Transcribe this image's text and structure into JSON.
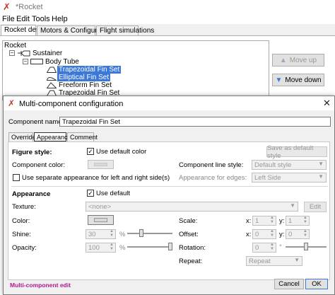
{
  "window": {
    "title": "*Rocket"
  },
  "menu": [
    "File",
    "Edit",
    "Tools",
    "Help"
  ],
  "main_tabs": [
    "Rocket design",
    "Motors & Configuration",
    "Flight simulations"
  ],
  "tree": {
    "root": "Rocket",
    "stage": "Sustainer",
    "body": "Body Tube",
    "items": [
      "Trapezoidal Fin Set",
      "Elliptical Fin Set",
      "Freeform Fin Set",
      "Trapezoidal Fin Set"
    ]
  },
  "side_buttons": {
    "move_up": "Move up",
    "move_down": "Move down"
  },
  "dialog": {
    "title": "Multi-component configuration",
    "component_name_label": "Component name:",
    "component_name_value": "Trapezoidal Fin Set",
    "tabs": [
      "Override",
      "Appearance",
      "Comment"
    ],
    "figure_style": {
      "heading": "Figure style:",
      "use_default_color": "Use default color",
      "save_default_style": "Save as default style",
      "component_color_label": "Component color:",
      "component_line_style_label": "Component line style:",
      "line_style_value": "Default style",
      "separate_appearance": "Use separate appearance for left and right side(s)",
      "appearance_edges_label": "Appearance for edges:",
      "edges_value": "Left Side"
    },
    "appearance": {
      "heading": "Appearance",
      "use_default": "Use default",
      "texture_label": "Texture:",
      "texture_value": "<none>",
      "edit": "Edit",
      "color_label": "Color:",
      "shine_label": "Shine:",
      "shine_value": "30",
      "shine_unit": "%",
      "shine_level_pct": 30,
      "opacity_label": "Opacity:",
      "opacity_value": "100",
      "opacity_unit": "%",
      "opacity_level_pct": 100,
      "scale_label": "Scale:",
      "scale_x": "1",
      "scale_y": "1",
      "offset_label": "Offset:",
      "offset_x": "0",
      "offset_y": "0",
      "rotation_label": "Rotation:",
      "rotation_value": "0",
      "rotation_unit": "°",
      "repeat_label": "Repeat:",
      "repeat_value": "Repeat",
      "x_label": "x:",
      "y_label": "y:"
    },
    "status": "Multi-component edit",
    "cancel": "Cancel",
    "ok": "OK"
  },
  "colors": {
    "selection": "#3c78d8",
    "status_text": "#b01890",
    "rocket_icon": "#c0392b"
  },
  "icons": [
    "rocket-icon",
    "close-icon",
    "arrow-up-icon",
    "arrow-down-icon"
  ]
}
